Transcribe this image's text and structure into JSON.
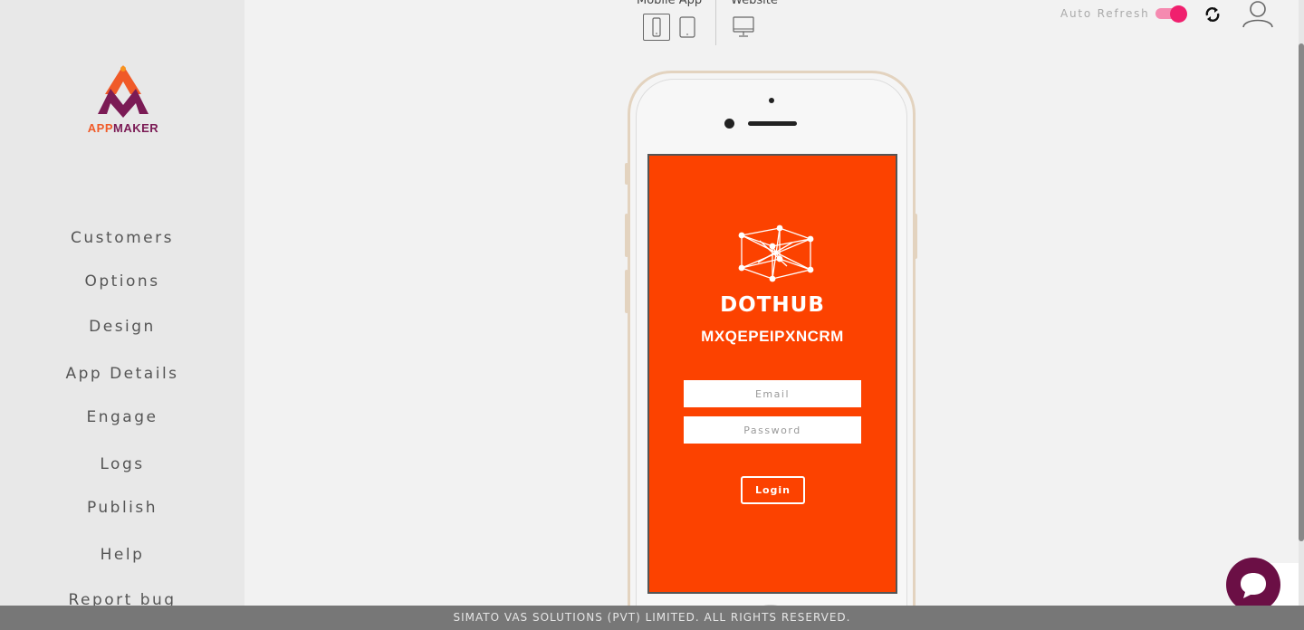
{
  "brand": {
    "logo_app": "APP",
    "logo_maker": "MAKER"
  },
  "sidebar": {
    "items": [
      {
        "label": "Customers"
      },
      {
        "label": "Options"
      },
      {
        "label": "Design"
      },
      {
        "label": "App Details"
      },
      {
        "label": "Engage"
      },
      {
        "label": "Logs"
      },
      {
        "label": "Publish"
      },
      {
        "label": "Help"
      },
      {
        "label": "Report bug"
      }
    ]
  },
  "preview": {
    "mobile_app_label": "Mobile App",
    "website_label": "Website",
    "devices": [
      {
        "icon": "phone-icon",
        "active": true
      },
      {
        "icon": "tablet-icon",
        "active": false
      },
      {
        "icon": "desktop-icon",
        "active": false
      }
    ]
  },
  "header": {
    "auto_refresh_label": "Auto Refresh",
    "auto_refresh_on": true,
    "accent_color": "#f0206e"
  },
  "app_screen": {
    "brand_text": "DOTHUB",
    "app_name": "MXQEPEIPXNCRM",
    "email_placeholder": "Email",
    "password_placeholder": "Password",
    "login_label": "Login",
    "background_color": "#fc4200"
  },
  "footer": {
    "text": "SIMATO VAS SOLUTIONS (PVT) LIMITED. ALL RIGHTS RESERVED."
  }
}
